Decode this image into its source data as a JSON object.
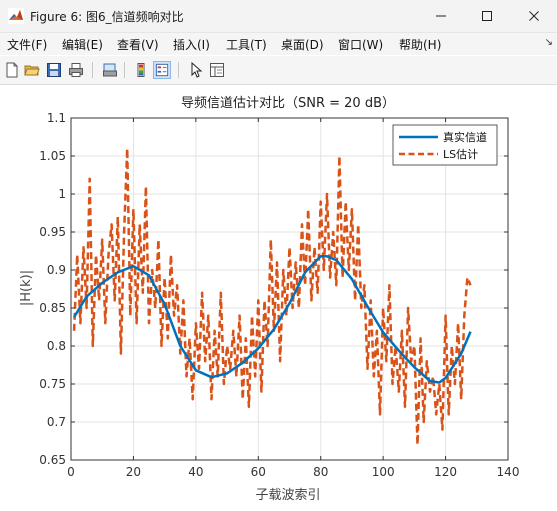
{
  "window": {
    "title": "Figure 6: 图6_信道频响对比",
    "controls": [
      "minimize",
      "maximize",
      "close"
    ]
  },
  "menubar": {
    "items": [
      "文件(F)",
      "编辑(E)",
      "查看(V)",
      "插入(I)",
      "工具(T)",
      "桌面(D)",
      "窗口(W)",
      "帮助(H)"
    ],
    "overflow_arrow": "↘"
  },
  "toolbar": {
    "buttons": [
      "new-figure-icon",
      "open-file-icon",
      "save-icon",
      "print-icon",
      "print-preview-icon",
      "colorbar-icon",
      "legend-icon",
      "pointer-icon",
      "property-inspector-icon"
    ],
    "active": "legend-icon"
  },
  "chart_data": {
    "type": "line",
    "title": "导频信道估计对比（SNR = 20 dB）",
    "xlabel": "子载波索引",
    "ylabel": "|H(k)|",
    "xlim": [
      0,
      140
    ],
    "ylim": [
      0.65,
      1.1
    ],
    "xticks": [
      0,
      20,
      40,
      60,
      80,
      100,
      120,
      140
    ],
    "xtick_labels": [
      "0",
      "20",
      "40",
      "60",
      "80",
      "100",
      "120",
      "140"
    ],
    "yticks": [
      0.65,
      0.7,
      0.75,
      0.8,
      0.85,
      0.9,
      0.95,
      1.0,
      1.05,
      1.1
    ],
    "ytick_labels": [
      "0.65",
      "0.7",
      "0.75",
      "0.8",
      "0.85",
      "0.9",
      "0.95",
      "1",
      "1.05",
      "1.1"
    ],
    "grid": true,
    "legend": "top-right",
    "series": [
      {
        "name": "真实信道",
        "color": "#0072BD",
        "style": "solid",
        "x": [
          1,
          5,
          10,
          15,
          20,
          25,
          30,
          35,
          40,
          45,
          50,
          55,
          60,
          65,
          70,
          75,
          80,
          82,
          85,
          90,
          95,
          100,
          105,
          110,
          115,
          118,
          120,
          125,
          128
        ],
        "y": [
          0.838,
          0.865,
          0.883,
          0.897,
          0.905,
          0.893,
          0.855,
          0.8,
          0.768,
          0.759,
          0.764,
          0.778,
          0.797,
          0.822,
          0.856,
          0.897,
          0.918,
          0.918,
          0.913,
          0.888,
          0.852,
          0.818,
          0.794,
          0.772,
          0.754,
          0.752,
          0.758,
          0.79,
          0.819
        ]
      },
      {
        "name": "LS估计",
        "color": "#D95319",
        "style": "dashed",
        "x": [
          1,
          2,
          3,
          4,
          5,
          6,
          7,
          8,
          9,
          10,
          11,
          12,
          13,
          14,
          15,
          16,
          17,
          18,
          19,
          20,
          21,
          22,
          23,
          24,
          25,
          26,
          27,
          28,
          29,
          30,
          31,
          32,
          33,
          34,
          35,
          36,
          37,
          38,
          39,
          40,
          41,
          42,
          43,
          44,
          45,
          46,
          47,
          48,
          49,
          50,
          51,
          52,
          53,
          54,
          55,
          56,
          57,
          58,
          59,
          60,
          61,
          62,
          63,
          64,
          65,
          66,
          67,
          68,
          69,
          70,
          71,
          72,
          73,
          74,
          75,
          76,
          77,
          78,
          79,
          80,
          81,
          82,
          83,
          84,
          85,
          86,
          87,
          88,
          89,
          90,
          91,
          92,
          93,
          94,
          95,
          96,
          97,
          98,
          99,
          100,
          101,
          102,
          103,
          104,
          105,
          106,
          107,
          108,
          109,
          110,
          111,
          112,
          113,
          114,
          115,
          116,
          117,
          118,
          119,
          120,
          121,
          122,
          123,
          124,
          125,
          126,
          127,
          128
        ],
        "y": [
          0.82,
          0.92,
          0.83,
          0.93,
          0.85,
          1.02,
          0.8,
          0.92,
          0.86,
          0.94,
          0.83,
          0.92,
          0.96,
          0.86,
          0.97,
          0.79,
          0.95,
          1.06,
          0.84,
          0.98,
          0.83,
          0.96,
          0.87,
          1.01,
          0.83,
          0.9,
          0.85,
          0.94,
          0.8,
          0.89,
          0.81,
          0.92,
          0.84,
          0.88,
          0.79,
          0.86,
          0.76,
          0.81,
          0.73,
          0.83,
          0.77,
          0.87,
          0.78,
          0.84,
          0.73,
          0.82,
          0.76,
          0.87,
          0.75,
          0.8,
          0.77,
          0.82,
          0.76,
          0.84,
          0.73,
          0.81,
          0.72,
          0.84,
          0.76,
          0.86,
          0.74,
          0.86,
          0.8,
          0.94,
          0.82,
          0.91,
          0.78,
          0.9,
          0.84,
          0.93,
          0.85,
          0.91,
          0.85,
          0.96,
          0.88,
          0.98,
          0.86,
          0.93,
          0.87,
          0.99,
          0.9,
          1.0,
          0.89,
          0.95,
          0.88,
          1.05,
          0.89,
          0.99,
          0.9,
          0.98,
          0.86,
          0.96,
          0.85,
          0.88,
          0.77,
          0.86,
          0.76,
          0.82,
          0.71,
          0.85,
          0.78,
          0.88,
          0.75,
          0.8,
          0.74,
          0.82,
          0.72,
          0.85,
          0.78,
          0.8,
          0.67,
          0.81,
          0.7,
          0.78,
          0.74,
          0.76,
          0.71,
          0.75,
          0.69,
          0.84,
          0.71,
          0.8,
          0.75,
          0.83,
          0.73,
          0.84,
          0.89,
          0.88
        ]
      }
    ]
  }
}
